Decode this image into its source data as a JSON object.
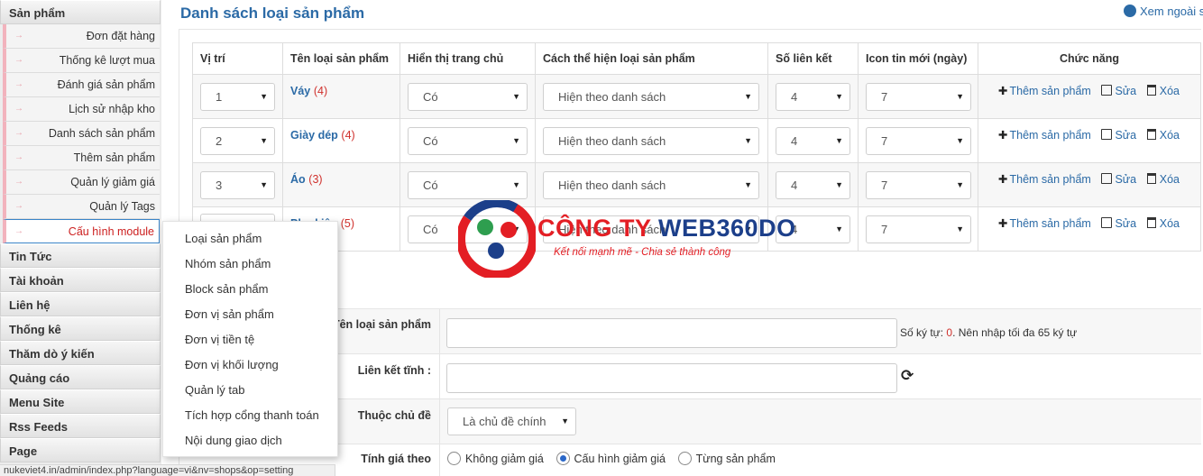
{
  "sidebar": {
    "section_top": "Sản phẩm",
    "items": [
      {
        "label": "Đơn đặt hàng"
      },
      {
        "label": "Thống kê lượt mua"
      },
      {
        "label": "Đánh giá sản phẩm"
      },
      {
        "label": "Lịch sử nhập kho"
      },
      {
        "label": "Danh sách sản phẩm"
      },
      {
        "label": "Thêm sản phẩm"
      },
      {
        "label": "Quản lý giảm giá"
      },
      {
        "label": "Quản lý Tags"
      },
      {
        "label": "Cấu hình module"
      }
    ],
    "active_item": "Cấu hình module",
    "sections": [
      "Tin Tức",
      "Tài khoản",
      "Liên hệ",
      "Thống kê",
      "Thăm dò ý kiến",
      "Quảng cáo",
      "Menu Site",
      "Rss Feeds",
      "Page"
    ]
  },
  "submenu": {
    "items": [
      "Loại sản phẩm",
      "Nhóm sản phẩm",
      "Block sản phẩm",
      "Đơn vị sản phẩm",
      "Đơn vị tiền tệ",
      "Đơn vị khối lượng",
      "Quản lý tab",
      "Tích hợp cổng thanh toán",
      "Nội dung giao dịch"
    ]
  },
  "header": {
    "title": "Danh sách loại sản phẩm",
    "view_site": "Xem ngoài si"
  },
  "table": {
    "columns": [
      "Vị trí",
      "Tên loại sản phẩm",
      "Hiển thị trang chủ",
      "Cách thể hiện loại sản phẩm",
      "Số liên kết",
      "Icon tin mới (ngày)",
      "Chức năng"
    ],
    "rows": [
      {
        "position": "1",
        "name": "Váy",
        "count": "(4)",
        "homepage": "Có",
        "display": "Hiện theo danh sách",
        "links": "4",
        "icon_days": "7"
      },
      {
        "position": "2",
        "name": "Giày dép",
        "count": "(4)",
        "homepage": "Có",
        "display": "Hiện theo danh sách",
        "links": "4",
        "icon_days": "7"
      },
      {
        "position": "3",
        "name": "Áo",
        "count": "(3)",
        "homepage": "Có",
        "display": "Hiện theo danh sách",
        "links": "4",
        "icon_days": "7"
      },
      {
        "position": "",
        "name": "Phụ kiện",
        "count": "(5)",
        "homepage": "Có",
        "display": "Hiện theo danh sách",
        "links": "4",
        "icon_days": "7"
      }
    ],
    "actions": {
      "add": "Thêm sản phẩm",
      "edit": "Sửa",
      "delete": "Xóa"
    }
  },
  "form": {
    "name_label": "Tên loại sản phẩm",
    "char_hint_prefix": "Số ký tự: ",
    "char_count": "0",
    "char_hint_suffix": ". Nên nhập tối đa 65 ký tự",
    "alias_label": "Liên kết tĩnh :",
    "parent_label": "Thuộc chủ đề",
    "parent_value": "Là chủ đề chính",
    "discount_label": "Tính giá theo",
    "discount_options": [
      "Không giảm giá",
      "Cấu hình giảm giá",
      "Từng sản phẩm"
    ],
    "discount_selected": "Cấu hình giảm giá"
  },
  "status_bar": {
    "url": "nukeviet4.in/admin/index.php?language=vi&nv=shops&op=setting"
  },
  "watermark": {
    "brand_part1": "CÔNG TY ",
    "brand_part2": "WEB360DO",
    "tagline": "Kết nối mạnh mẽ - Chia sẻ thành công"
  },
  "colors": {
    "accent_blue": "#2b6aa6",
    "count_red": "#d0312d",
    "sidebar_marker": "#f2b3bd",
    "brand_red": "#e31e24",
    "brand_blue": "#1c3f8a"
  }
}
